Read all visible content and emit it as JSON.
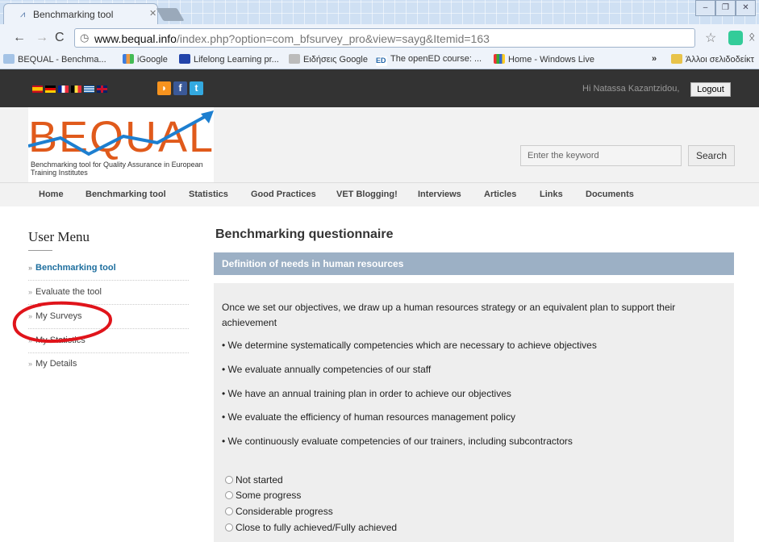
{
  "browser": {
    "tab_title": "Benchmarking tool",
    "url_domain": "www.bequal.info",
    "url_path": "/index.php?option=com_bfsurvey_pro&view=sayg&Itemid=163",
    "bookmarks": [
      "BEQUAL - Benchma...",
      "iGoogle",
      "Lifelong Learning pr...",
      "Ειδήσεις Google",
      "The openED course: ...",
      "Home - Windows Live",
      "Άλλοι σελιδοδείκτ"
    ],
    "bookmarks_overflow": "»"
  },
  "topbar": {
    "greeting": "Hi Natassa Kazantzidou,",
    "logout_label": "Logout"
  },
  "header": {
    "logo_text": "BEQUAL",
    "logo_tagline": "Benchmarking tool for Quality Assurance in European Training Institutes",
    "search_placeholder": "Enter the keyword",
    "search_label": "Search"
  },
  "nav": [
    "Home",
    "Benchmarking tool",
    "Statistics",
    "Good Practices",
    "VET Blogging!",
    "Interviews",
    "Articles",
    "Links",
    "Documents"
  ],
  "sidebar": {
    "title": "User Menu",
    "items": [
      "Benchmarking tool",
      "Evaluate the tool",
      "My Surveys",
      "My Statistics",
      "My Details"
    ]
  },
  "questionnaire": {
    "title": "Benchmarking questionnaire",
    "section": "Definition of needs in human resources",
    "lead": "Once we set our objectives, we draw up a human resources strategy or an equivalent plan to support their achievement",
    "bullets": [
      "• We determine systematically competencies which are necessary to achieve objectives",
      "• We evaluate annually competencies of our staff",
      "• We have an annual training plan in order to achieve our objectives",
      "• We evaluate the efficiency of human resources management policy",
      "• We continuously evaluate competencies of our trainers, including subcontractors"
    ],
    "options": [
      "Not started",
      "Some progress",
      "Considerable progress",
      "Close to fully achieved/Fully achieved"
    ]
  },
  "colors": {
    "logo_orange": "#e05a1b",
    "logo_arrow_blue": "#1d7fd0",
    "section_bar": "#9cb0c5",
    "active_link": "#1d6e9e",
    "annotation_red": "#e0141b"
  }
}
